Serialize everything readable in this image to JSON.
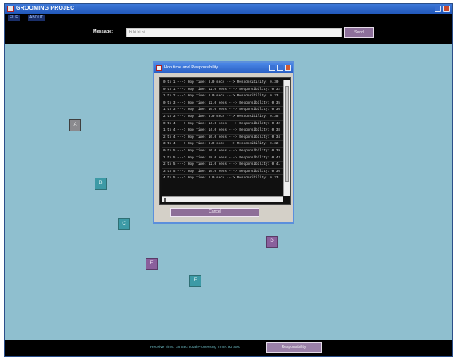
{
  "window": {
    "title": "GROOMING PROJECT"
  },
  "menu": {
    "items": [
      "FILE",
      "ABOUT"
    ]
  },
  "message_bar": {
    "label": "Message:",
    "input_value": "hi hi hi hi",
    "send_label": "Send"
  },
  "nodes": [
    {
      "label": "A",
      "color": "gray"
    },
    {
      "label": "B",
      "color": "teal"
    },
    {
      "label": "C",
      "color": "teal"
    },
    {
      "label": "D",
      "color": "purple"
    },
    {
      "label": "E",
      "color": "purple"
    },
    {
      "label": "F",
      "color": "teal"
    }
  ],
  "dialog": {
    "title": "Hop time and Responsibility",
    "rows": [
      "0 to 1 ---> Hop Time: 6.0 secs ---> Responsibility: 0.30",
      "0 to 1 ---> Hop Time: 12.0 secs ---> Responsibility: 0.32",
      "1 to 2 ---> Hop Time: 6.0 secs ---> Responsibility: 0.33",
      "0 to 3 ---> Hop Time: 12.0 secs ---> Responsibility: 0.35",
      "1 to 3 ---> Hop Time: 10.0 secs ---> Responsibility: 0.36",
      "2 to 3 ---> Hop Time: 6.0 secs ---> Responsibility: 0.38",
      "0 to 4 ---> Hop Time: 14.0 secs ---> Responsibility: 0.42",
      "1 to 4 ---> Hop Time: 14.0 secs ---> Responsibility: 0.38",
      "2 to 4 ---> Hop Time: 10.0 secs ---> Responsibility: 0.34",
      "3 to 4 ---> Hop Time: 6.0 secs ---> Responsibility: 0.32",
      "0 to 5 ---> Hop Time: 16.0 secs ---> Responsibility: 0.39",
      "1 to 5 ---> Hop Time: 18.0 secs ---> Responsibility: 0.43",
      "2 to 5 ---> Hop Time: 12.0 secs ---> Responsibility: 0.41",
      "3 to 5 ---> Hop Time: 10.0 secs ---> Responsibility: 0.36",
      "4 to 5 ---> Hop Time: 6.0 secs ---> Responsibility: 0.33"
    ],
    "cancel_label": "Cancel"
  },
  "footer": {
    "status_text": "Receive Time: 18 Sec  Total Processing Time: 92 Sec",
    "responsibility_label": "Responsibility"
  },
  "colors": {
    "background": "#8fbfcf",
    "bar": "#000000",
    "accent_button": "#8d6f9a",
    "titlebar": "#2a5fc4"
  }
}
